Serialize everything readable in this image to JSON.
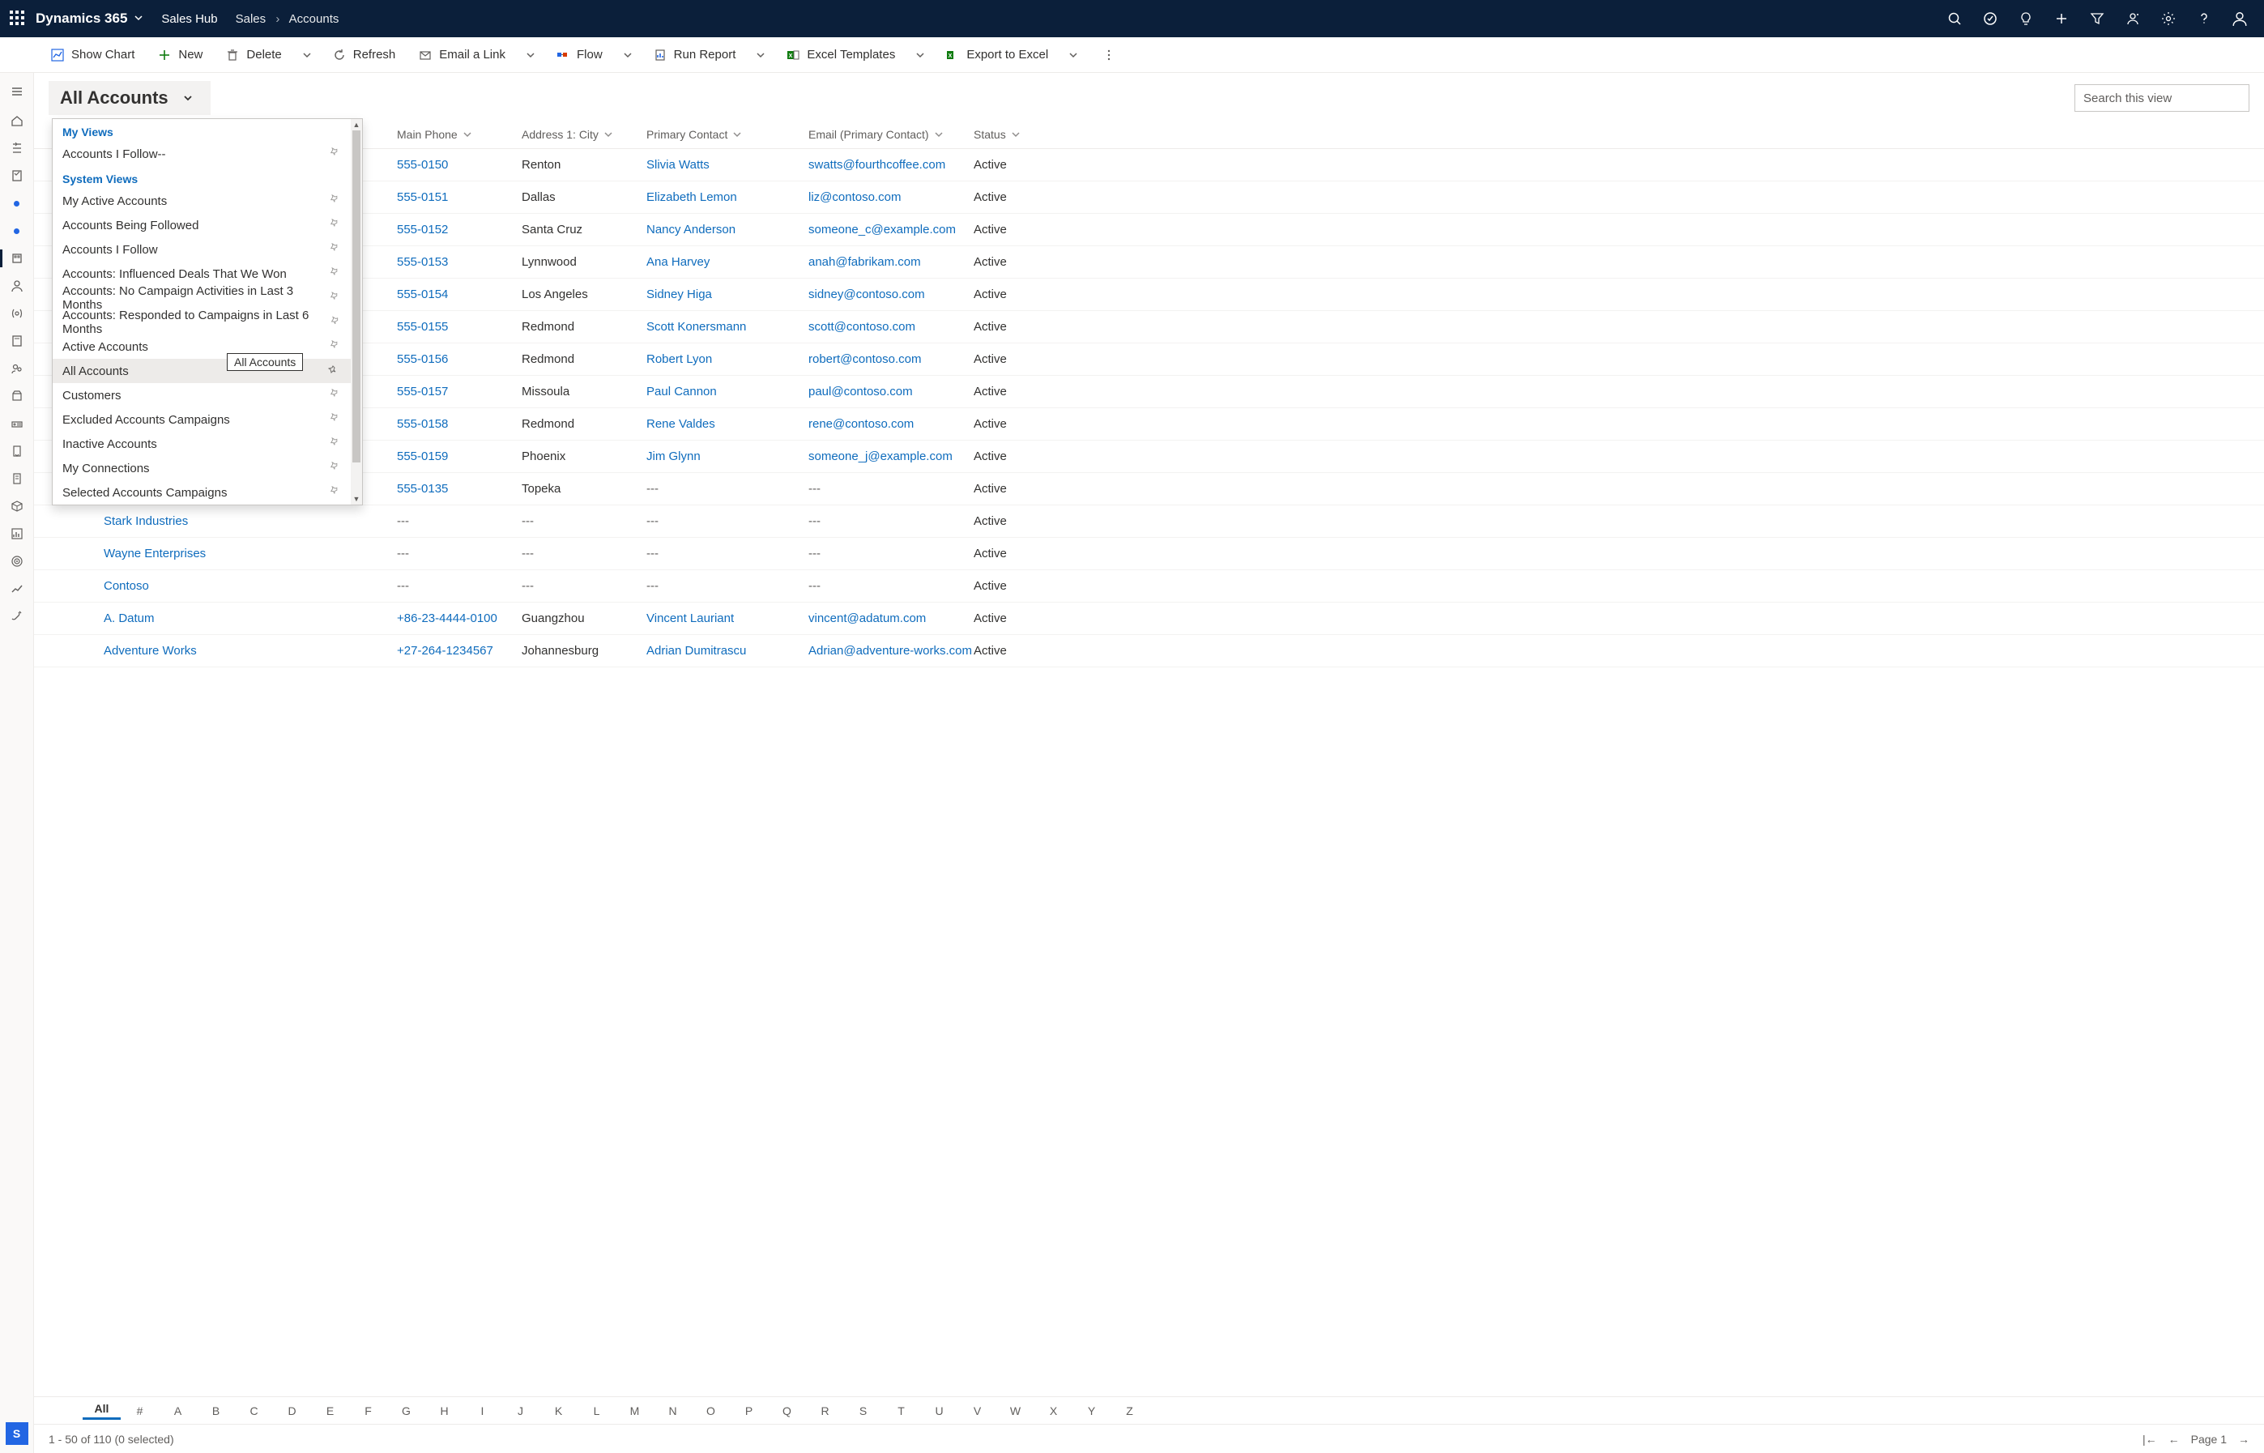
{
  "header": {
    "brand": "Dynamics 365",
    "app": "Sales Hub",
    "crumb_root": "Sales",
    "crumb_leaf": "Accounts"
  },
  "commands": {
    "show_chart": "Show Chart",
    "new": "New",
    "delete": "Delete",
    "refresh": "Refresh",
    "email_link": "Email a Link",
    "flow": "Flow",
    "run_report": "Run Report",
    "excel_templates": "Excel Templates",
    "export_excel": "Export to Excel"
  },
  "view": {
    "title": "All Accounts",
    "search_placeholder": "Search this view",
    "tooltip": "All Accounts",
    "dropdown": {
      "my_views_hdr": "My Views",
      "system_views_hdr": "System Views",
      "my_views": [
        "Accounts I Follow--"
      ],
      "system_views": [
        "My Active Accounts",
        "Accounts Being Followed",
        "Accounts I Follow",
        "Accounts: Influenced Deals That We Won",
        "Accounts: No Campaign Activities in Last 3 Months",
        "Accounts: Responded to Campaigns in Last 6 Months",
        "Active Accounts",
        "All Accounts",
        "Customers",
        "Excluded Accounts Campaigns",
        "Inactive Accounts",
        "My Connections",
        "Selected Accounts Campaigns"
      ],
      "selected": "All Accounts"
    }
  },
  "columns": {
    "phone": "Main Phone",
    "city": "Address 1: City",
    "contact": "Primary Contact",
    "email": "Email (Primary Contact)",
    "status": "Status"
  },
  "rows": [
    {
      "name": "",
      "phone": "555-0150",
      "city": "Renton",
      "contact": "Slivia Watts",
      "email": "swatts@fourthcoffee.com",
      "status": "Active"
    },
    {
      "name": "",
      "phone": "555-0151",
      "city": "Dallas",
      "contact": "Elizabeth Lemon",
      "email": "liz@contoso.com",
      "status": "Active"
    },
    {
      "name": "",
      "phone": "555-0152",
      "city": "Santa Cruz",
      "contact": "Nancy Anderson",
      "email": "someone_c@example.com",
      "status": "Active"
    },
    {
      "name": "",
      "phone": "555-0153",
      "city": "Lynnwood",
      "contact": "Ana Harvey",
      "email": "anah@fabrikam.com",
      "status": "Active"
    },
    {
      "name": "",
      "phone": "555-0154",
      "city": "Los Angeles",
      "contact": "Sidney Higa",
      "email": "sidney@contoso.com",
      "status": "Active"
    },
    {
      "name": "",
      "phone": "555-0155",
      "city": "Redmond",
      "contact": "Scott Konersmann",
      "email": "scott@contoso.com",
      "status": "Active"
    },
    {
      "name": "",
      "phone": "555-0156",
      "city": "Redmond",
      "contact": "Robert Lyon",
      "email": "robert@contoso.com",
      "status": "Active"
    },
    {
      "name": "",
      "phone": "555-0157",
      "city": "Missoula",
      "contact": "Paul Cannon",
      "email": "paul@contoso.com",
      "status": "Active"
    },
    {
      "name": "",
      "phone": "555-0158",
      "city": "Redmond",
      "contact": "Rene Valdes",
      "email": "rene@contoso.com",
      "status": "Active"
    },
    {
      "name": "",
      "phone": "555-0159",
      "city": "Phoenix",
      "contact": "Jim Glynn",
      "email": "someone_j@example.com",
      "status": "Active"
    },
    {
      "name": "",
      "phone": "555-0135",
      "city": "Topeka",
      "contact": "---",
      "email": "---",
      "status": "Active"
    },
    {
      "name": "Stark Industries",
      "phone": "---",
      "city": "---",
      "contact": "---",
      "email": "---",
      "status": "Active"
    },
    {
      "name": "Wayne Enterprises",
      "phone": "---",
      "city": "---",
      "contact": "---",
      "email": "---",
      "status": "Active"
    },
    {
      "name": "Contoso",
      "phone": "---",
      "city": "---",
      "contact": "---",
      "email": "---",
      "status": "Active"
    },
    {
      "name": "A. Datum",
      "phone": "+86-23-4444-0100",
      "city": "Guangzhou",
      "contact": "Vincent Lauriant",
      "email": "vincent@adatum.com",
      "status": "Active"
    },
    {
      "name": "Adventure Works",
      "phone": "+27-264-1234567",
      "city": "Johannesburg",
      "contact": "Adrian Dumitrascu",
      "email": "Adrian@adventure-works.com",
      "status": "Active"
    }
  ],
  "alpha": [
    "All",
    "#",
    "A",
    "B",
    "C",
    "D",
    "E",
    "F",
    "G",
    "H",
    "I",
    "J",
    "K",
    "L",
    "M",
    "N",
    "O",
    "P",
    "Q",
    "R",
    "S",
    "T",
    "U",
    "V",
    "W",
    "X",
    "Y",
    "Z"
  ],
  "footer": {
    "count": "1 - 50 of 110 (0 selected)",
    "page": "Page 1"
  },
  "leftrail_badge": "S"
}
